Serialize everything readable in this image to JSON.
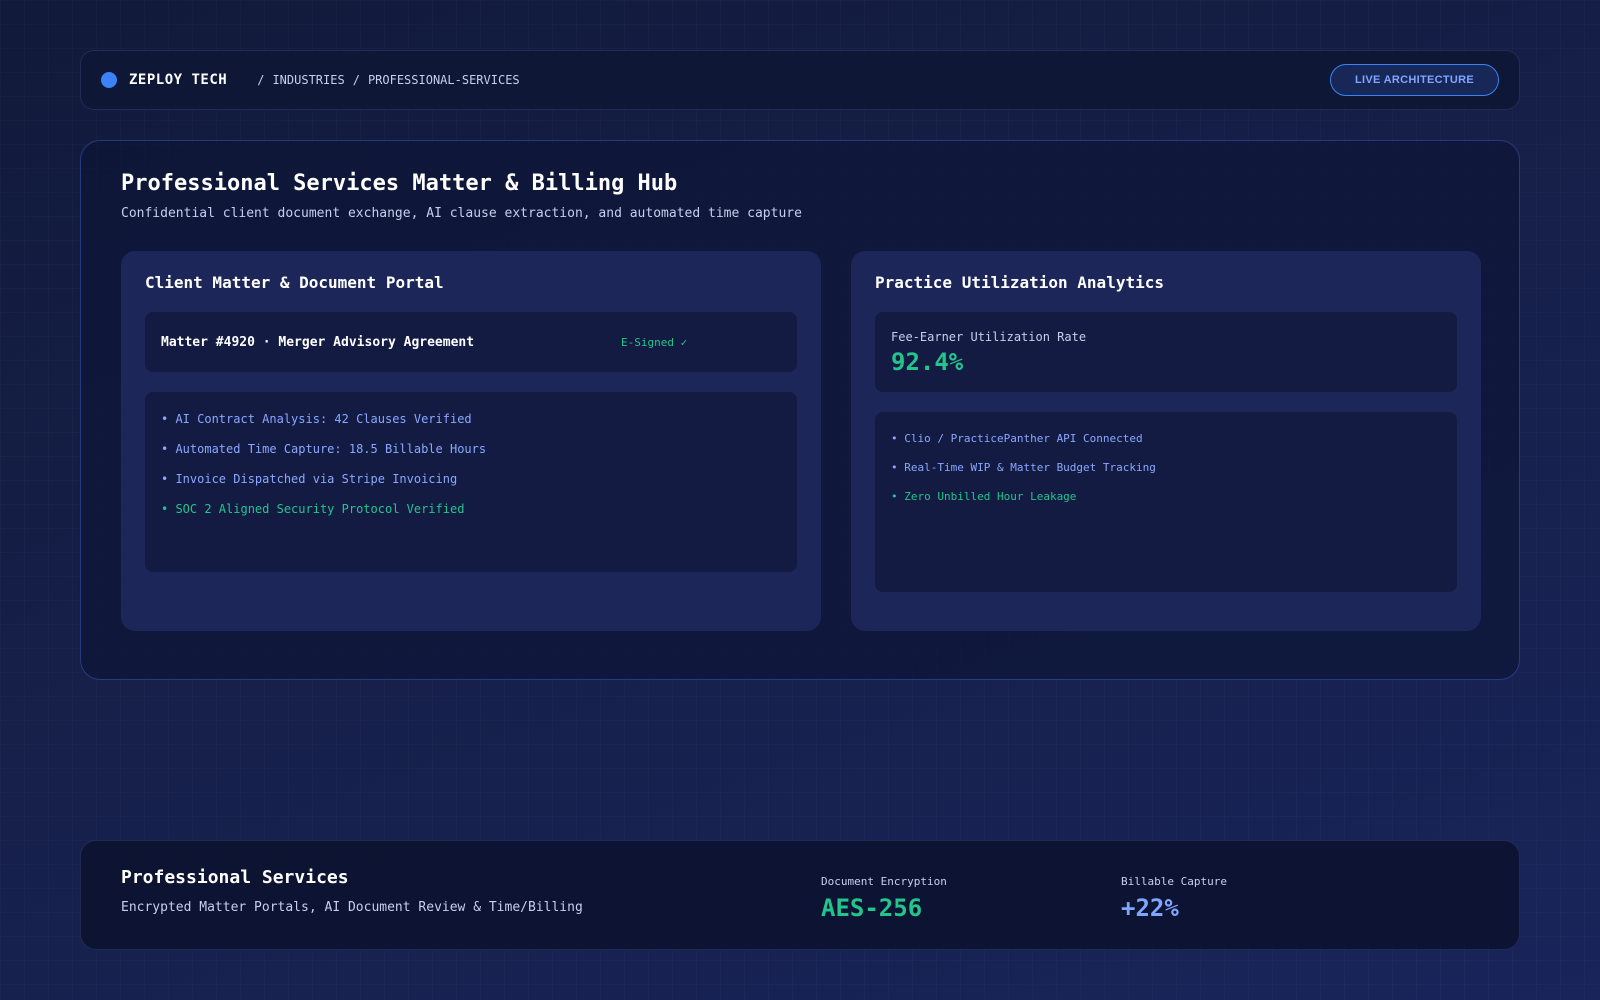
{
  "header": {
    "brand": "ZEPLOY TECH",
    "breadcrumb": [
      "/",
      "INDUSTRIES",
      "/",
      "PROFESSIONAL-SERVICES"
    ],
    "live_button": "LIVE ARCHITECTURE"
  },
  "hub": {
    "title": "Professional Services Matter & Billing Hub",
    "subtitle": "Confidential client document exchange, AI clause extraction, and automated time capture"
  },
  "portal": {
    "title": "Client Matter & Document Portal",
    "matter_title": "Matter #4920 · Merger Advisory Agreement",
    "matter_status": "E-Signed ✓",
    "items": [
      "• AI Contract Analysis: 42 Clauses Verified",
      "• Automated Time Capture: 18.5 Billable Hours",
      "• Invoice Dispatched via Stripe Invoicing",
      "• SOC 2 Aligned Security Protocol Verified"
    ]
  },
  "analytics": {
    "title": "Practice Utilization Analytics",
    "metric_label": "Fee-Earner Utilization Rate",
    "metric_value": "92.4%",
    "items": [
      "• Clio / PracticePanther API Connected",
      "• Real-Time WIP & Matter Budget Tracking",
      "• Zero Unbilled Hour Leakage"
    ]
  },
  "footer": {
    "title": "Professional Services",
    "subtitle": "Encrypted Matter Portals, AI Document Review & Time/Billing",
    "stats": [
      {
        "label": "Document Encryption",
        "value": "AES-256"
      },
      {
        "label": "Billable Capture",
        "value": "+22%"
      }
    ]
  },
  "colors": {
    "accent_blue": "#3b82f6",
    "success_green": "#22c58b",
    "link_blue": "#8aa7ff"
  }
}
